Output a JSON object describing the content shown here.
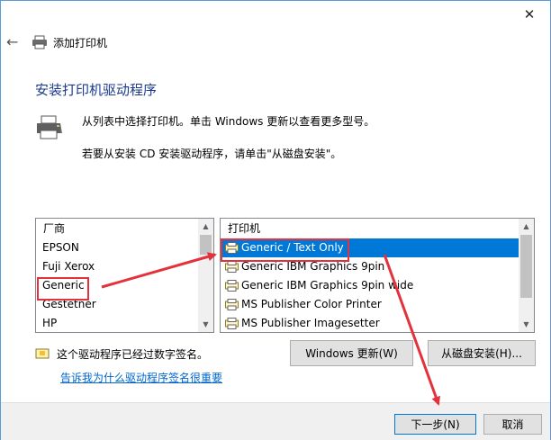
{
  "window": {
    "title": "添加打印机",
    "close_glyph": "✕",
    "back_glyph": "←"
  },
  "heading": "安装打印机驱动程序",
  "description": {
    "line1": "从列表中选择打印机。单击 Windows 更新以查看更多型号。",
    "line2": "若要从安装 CD 安装驱动程序，请单击\"从磁盘安装\"。"
  },
  "manufacturers": {
    "header": "厂商",
    "items": [
      "EPSON",
      "Fuji Xerox",
      "Generic",
      "Gestetner",
      "HP"
    ],
    "selected": "Generic"
  },
  "printers": {
    "header": "打印机",
    "items": [
      "Generic / Text Only",
      "Generic IBM Graphics 9pin",
      "Generic IBM Graphics 9pin wide",
      "MS Publisher Color Printer",
      "MS Publisher Imagesetter"
    ],
    "selected": "Generic / Text Only"
  },
  "driver_signed": "这个驱动程序已经过数字签名。",
  "signing_link": "告诉我为什么驱动程序签名很重要",
  "buttons": {
    "windows_update": "Windows 更新(W)",
    "have_disk": "从磁盘安装(H)...",
    "next": "下一步(N)",
    "cancel": "取消"
  },
  "colors": {
    "accent": "#0078d7",
    "heading": "#1b3a8c",
    "annotation": "#e3323b",
    "link": "#0066cc"
  }
}
